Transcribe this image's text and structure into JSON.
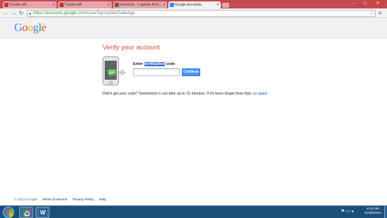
{
  "browser": {
    "tabs": [
      {
        "label": "Travian sl8",
        "favicon_color": "#c0392b"
      },
      {
        "label": "Travian sl8",
        "favicon_color": "#c0392b"
      },
      {
        "label": "Konvertor - Laporan Pert...",
        "favicon_color": "#7a5c2e"
      },
      {
        "label": "Google Accounts",
        "favicon_color": "#4285f4"
      }
    ],
    "window_controls": {
      "minimize": "–",
      "maximize": "□",
      "close": "✕"
    },
    "url_host": "https://accounts.google.com",
    "url_path": "/UserSignUpIdvChallenge"
  },
  "header": {
    "logo_text": "Google"
  },
  "verify": {
    "title": "Verify your account",
    "enter_prefix": "Enter ",
    "enter_highlight": "verification",
    "enter_suffix": " code",
    "code_value": "",
    "continue_label": "Continue",
    "help_text": "Didn't get your code? Sometimes it can take up to 15 minutes. If it's been longer than that, ",
    "help_link": "try again",
    "help_end": "."
  },
  "footer": {
    "copyright": "© 2012 Google",
    "terms": "Terms of Service",
    "privacy": "Privacy Policy",
    "help": "Help"
  },
  "taskbar": {
    "time": "8:32 AM",
    "date": "11/28/2012"
  }
}
